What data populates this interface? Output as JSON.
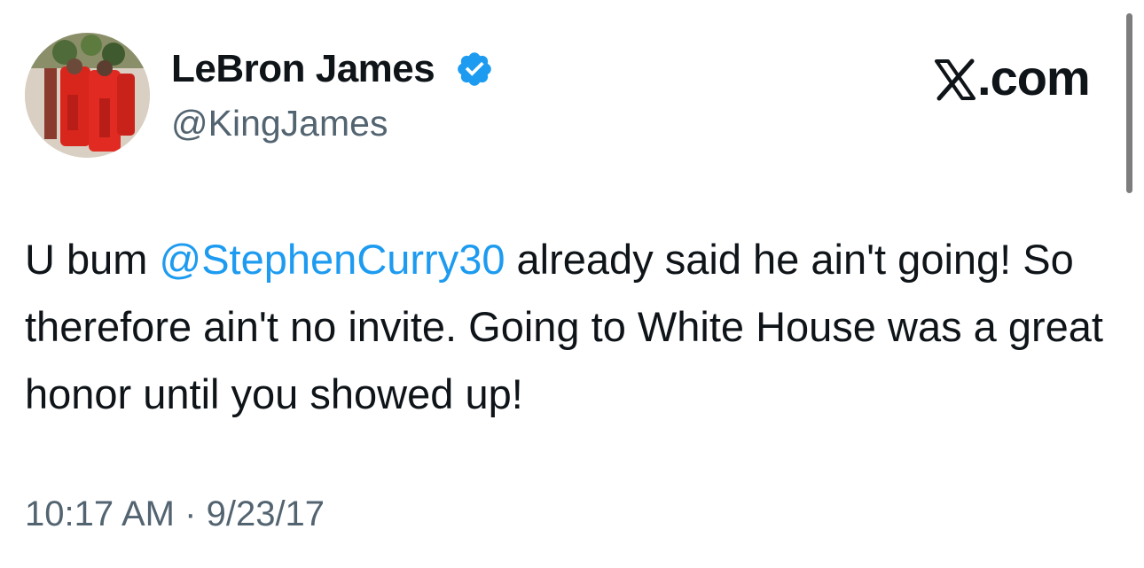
{
  "author": {
    "display_name": "LeBron James",
    "handle": "@KingJames",
    "verified": true,
    "avatar_alt": "profile photo"
  },
  "brand": {
    "domain": "com",
    "dot": ".",
    "logo_icon": "x-logo-icon"
  },
  "tweet": {
    "text_before": "U bum ",
    "mention": "@StephenCurry30",
    "text_after": " already said he ain't going! So therefore ain't no invite. Going to White House was a great honor until you showed up!",
    "time": "10:17 AM",
    "separator": "·",
    "date": "9/23/17"
  },
  "colors": {
    "text": "#0f1419",
    "muted": "#536471",
    "mention": "#1d9bf0",
    "verified_badge": "#1d9bf0"
  }
}
